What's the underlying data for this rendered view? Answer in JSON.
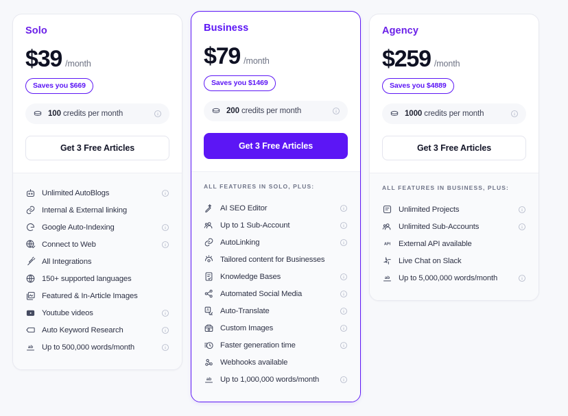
{
  "accent": "#5c16f5",
  "plans": [
    {
      "name": "Solo",
      "price": "$39",
      "period": "/month",
      "savings": "Saves you $669",
      "credits_amount": "100",
      "credits_suffix": "credits per month",
      "cta": "Get 3 Free Articles",
      "features_heading": "",
      "features": [
        {
          "label": "Unlimited AutoBlogs",
          "icon": "robot-icon",
          "info": true
        },
        {
          "label": "Internal & External linking",
          "icon": "link-icon",
          "info": false
        },
        {
          "label": "Google Auto-Indexing",
          "icon": "google-icon",
          "info": true
        },
        {
          "label": "Connect to Web",
          "icon": "globe-check-icon",
          "info": true
        },
        {
          "label": "All Integrations",
          "icon": "plug-icon",
          "info": false
        },
        {
          "label": "150+ supported languages",
          "icon": "globe-icon",
          "info": false
        },
        {
          "label": "Featured & In-Article Images",
          "icon": "images-icon",
          "info": false
        },
        {
          "label": "Youtube videos",
          "icon": "video-icon",
          "info": true
        },
        {
          "label": "Auto Keyword Research",
          "icon": "tag-icon",
          "info": true
        },
        {
          "label": "Up to 500,000 words/month",
          "icon": "abc-icon",
          "info": true
        }
      ]
    },
    {
      "name": "Business",
      "price": "$79",
      "period": "/month",
      "savings": "Saves you $1469",
      "credits_amount": "200",
      "credits_suffix": "credits per month",
      "cta": "Get 3 Free Articles",
      "features_heading": "ALL FEATURES IN SOLO, PLUS:",
      "features": [
        {
          "label": "AI SEO Editor",
          "icon": "magic-pen-icon",
          "info": true
        },
        {
          "label": "Up to 1 Sub-Account",
          "icon": "users-icon",
          "info": true
        },
        {
          "label": "AutoLinking",
          "icon": "link-icon",
          "info": true
        },
        {
          "label": "Tailored content for Businesses",
          "icon": "eye-idea-icon",
          "info": false
        },
        {
          "label": "Knowledge Bases",
          "icon": "book-check-icon",
          "info": true
        },
        {
          "label": "Automated Social Media",
          "icon": "share-icon",
          "info": true
        },
        {
          "label": "Auto-Translate",
          "icon": "translate-icon",
          "info": true
        },
        {
          "label": "Custom Images",
          "icon": "image-frame-icon",
          "info": true
        },
        {
          "label": "Faster generation time",
          "icon": "clock-fast-icon",
          "info": true
        },
        {
          "label": "Webhooks available",
          "icon": "webhook-icon",
          "info": false
        },
        {
          "label": "Up to 1,000,000 words/month",
          "icon": "abc-icon",
          "info": true
        }
      ]
    },
    {
      "name": "Agency",
      "price": "$259",
      "period": "/month",
      "savings": "Saves you $4889",
      "credits_amount": "1000",
      "credits_suffix": "credits per month",
      "cta": "Get 3 Free Articles",
      "features_heading": "ALL FEATURES IN BUSINESS, PLUS:",
      "features": [
        {
          "label": "Unlimited Projects",
          "icon": "project-icon",
          "info": true
        },
        {
          "label": "Unlimited Sub-Accounts",
          "icon": "users-icon",
          "info": true
        },
        {
          "label": "External API available",
          "icon": "api-icon",
          "info": false
        },
        {
          "label": "Live Chat on Slack",
          "icon": "slack-icon",
          "info": false
        },
        {
          "label": "Up to 5,000,000 words/month",
          "icon": "abc-icon",
          "info": true
        }
      ]
    }
  ]
}
